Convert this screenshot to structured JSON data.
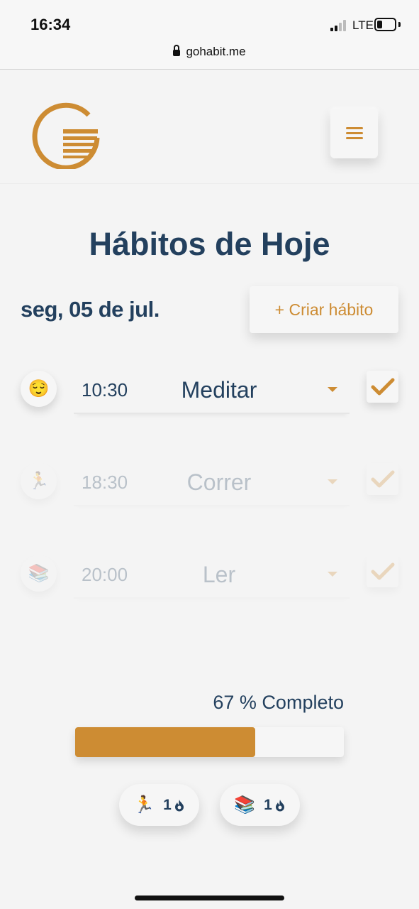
{
  "status_bar": {
    "time": "16:34",
    "network": "LTE"
  },
  "browser": {
    "url": "gohabit.me"
  },
  "header": {
    "menu_icon": "hamburger-icon"
  },
  "page": {
    "title": "Hábitos de Hoje",
    "date": "seg, 05 de jul.",
    "create_button": "+ Criar hábito"
  },
  "habits": [
    {
      "emoji": "😌",
      "time": "10:30",
      "name": "Meditar",
      "done": true
    },
    {
      "emoji": "🏃",
      "time": "18:30",
      "name": "Correr",
      "done": false
    },
    {
      "emoji": "📚",
      "time": "20:00",
      "name": "Ler",
      "done": false
    }
  ],
  "progress": {
    "label": "67 % Completo",
    "value": 0.67
  },
  "streaks": [
    {
      "emoji": "🏃",
      "count": "1"
    },
    {
      "emoji": "📚",
      "count": "1"
    }
  ],
  "colors": {
    "accent": "#cd8c33",
    "navy": "#23405e",
    "background": "#f4f4f4"
  }
}
